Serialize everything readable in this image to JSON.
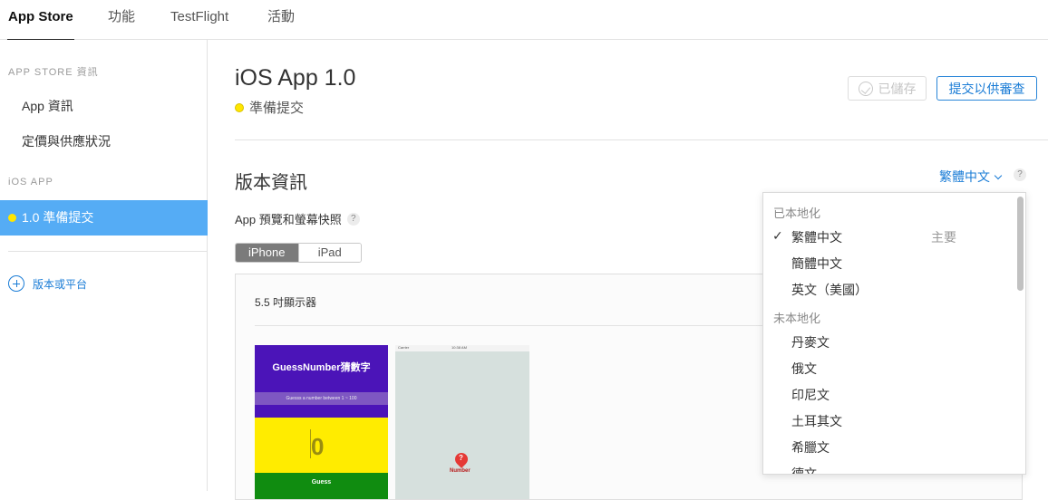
{
  "topnav": {
    "tabs": [
      {
        "label": "App Store",
        "active": true
      },
      {
        "label": "功能",
        "active": false
      },
      {
        "label": "TestFlight",
        "active": false
      },
      {
        "label": "活動",
        "active": false
      }
    ]
  },
  "sidebar": {
    "section1": "APP STORE 資訊",
    "item_app_info": "App 資訊",
    "item_pricing": "定價與供應狀況",
    "section2": "iOS APP",
    "selected_version": "1.0 準備提交",
    "add_label": "版本或平台"
  },
  "main": {
    "title": "iOS App 1.0",
    "status": "準備提交",
    "saved_label": "已儲存",
    "submit_label": "提交以供審查",
    "section_title": "版本資訊",
    "language_selected": "繁體中文",
    "preview_label": "App 預覽和螢幕快照",
    "help": "?",
    "devices": [
      "iPhone",
      "iPad"
    ],
    "display_label": "5.5 吋顯示器"
  },
  "screenshot1": {
    "title": "GuessNumber猜數字",
    "subtitle": "Guesss a number between 1 ~ 100",
    "number": "0",
    "button": "Guess"
  },
  "screenshot2": {
    "carrier": "Carrier",
    "time": "10:38 AM",
    "pin_symbol": "?",
    "label": "Number"
  },
  "dropdown": {
    "localized_header": "已本地化",
    "localized": [
      {
        "label": "繁體中文",
        "checked": true,
        "primary": "主要"
      },
      {
        "label": "簡體中文",
        "checked": false
      },
      {
        "label": "英文（美國）",
        "checked": false
      }
    ],
    "unlocalized_header": "未本地化",
    "unlocalized": [
      "丹麥文",
      "俄文",
      "印尼文",
      "土耳其文",
      "希臘文",
      "德文"
    ],
    "check_mark": "✓"
  },
  "colors": {
    "accent": "#1a7cd6",
    "selected_bg": "#55acf5",
    "status_yellow": "#ffe600"
  }
}
